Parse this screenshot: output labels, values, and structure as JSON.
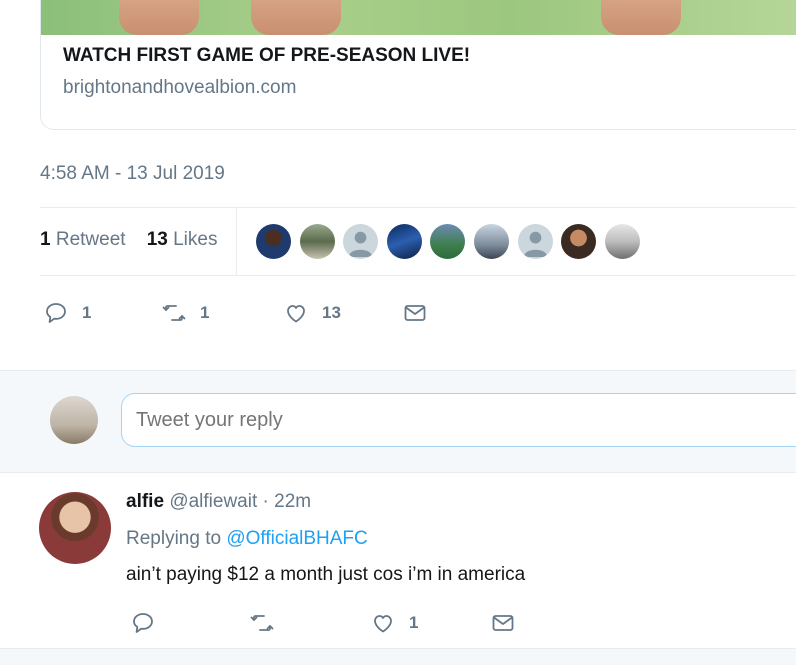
{
  "link_card": {
    "title": "WATCH FIRST GAME OF PRE-SEASON LIVE!",
    "domain": "brightonandhovealbion.com"
  },
  "tweet": {
    "timestamp": "4:58 AM - 13 Jul 2019",
    "stats": {
      "retweet_count": "1",
      "retweet_label": "Retweet",
      "like_count": "13",
      "like_label": "Likes"
    },
    "actions": {
      "reply_count": "1",
      "retweet_count": "1",
      "like_count": "13"
    }
  },
  "reply_box": {
    "placeholder": "Tweet your reply"
  },
  "reply": {
    "name": "alfie",
    "handle": "@alfiewait",
    "separator": "·",
    "time": "22m",
    "replying_prefix": "Replying to",
    "replying_to": "@OfficialBHAFC",
    "text": "ain’t paying $12 a month just cos i’m in america",
    "actions": {
      "like_count": "1"
    }
  },
  "colors": {
    "accent": "#1da1f2",
    "muted": "#657786",
    "border": "#e6ecf0"
  }
}
